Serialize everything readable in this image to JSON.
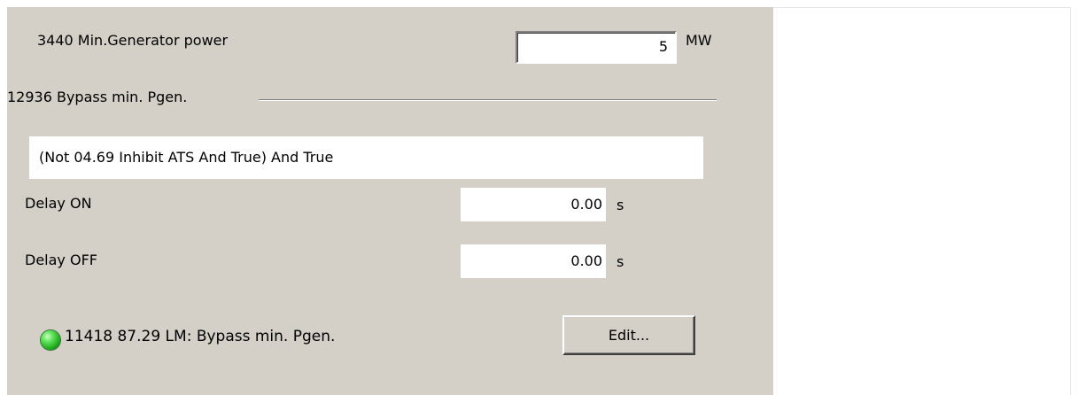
{
  "min_power": {
    "label": "3440 Min.Generator power",
    "value": "5",
    "unit": "MW"
  },
  "bypass_group": {
    "label": "12936 Bypass min. Pgen."
  },
  "expression": "(Not 04.69 Inhibit ATS And True) And True",
  "delay_on": {
    "label": "Delay ON",
    "value": "0.00",
    "unit": "s"
  },
  "delay_off": {
    "label": "Delay OFF",
    "value": "0.00",
    "unit": "s"
  },
  "status": {
    "indicator_color": "#2ec02e",
    "text": "11418 87.29 LM: Bypass min. Pgen."
  },
  "edit_button": {
    "label": "Edit..."
  }
}
